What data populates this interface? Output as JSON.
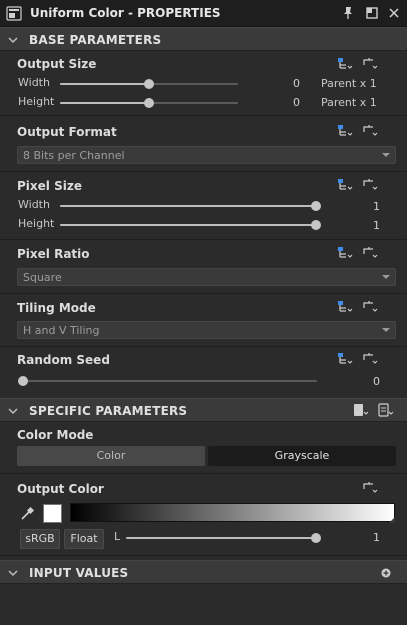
{
  "window": {
    "title": "Uniform Color - PROPERTIES"
  },
  "sections": {
    "base": {
      "label": "BASE PARAMETERS"
    },
    "specific": {
      "label": "SPECIFIC PARAMETERS"
    },
    "inputs": {
      "label": "INPUT VALUES"
    }
  },
  "output_size": {
    "title": "Output Size",
    "width": {
      "label": "Width",
      "value": "0",
      "extra": "Parent x 1",
      "level": 0.5
    },
    "height": {
      "label": "Height",
      "value": "0",
      "extra": "Parent x 1",
      "level": 0.5
    }
  },
  "output_format": {
    "title": "Output Format",
    "selected": "8 Bits per Channel"
  },
  "pixel_size": {
    "title": "Pixel Size",
    "width": {
      "label": "Width",
      "value": "1",
      "level": 1.0
    },
    "height": {
      "label": "Height",
      "value": "1",
      "level": 1.0
    }
  },
  "pixel_ratio": {
    "title": "Pixel Ratio",
    "selected": "Square"
  },
  "tiling_mode": {
    "title": "Tiling Mode",
    "selected": "H and V Tiling"
  },
  "random_seed": {
    "title": "Random Seed",
    "value": "0",
    "level": 0.0
  },
  "color_mode": {
    "title": "Color Mode",
    "options": [
      "Color",
      "Grayscale"
    ],
    "selected": "Grayscale"
  },
  "output_color": {
    "title": "Output Color",
    "swatch": "#ffffff",
    "srgb_label": "sRGB",
    "float_label": "Float",
    "channel_label": "L",
    "value": "1",
    "level": 1.0
  },
  "icons": {
    "window": "app-icon",
    "pin": "pin-icon",
    "restore": "window-icon",
    "close": "close-icon",
    "expose": "expose-parameter-icon",
    "link": "link-parameter-icon",
    "eyedropper": "eyedropper-icon",
    "preset": "preset-icon",
    "add": "add-icon"
  },
  "colors": {
    "accent": "#3d8ee8",
    "panel": "#2b2b2b",
    "header": "#3a3a3a"
  }
}
